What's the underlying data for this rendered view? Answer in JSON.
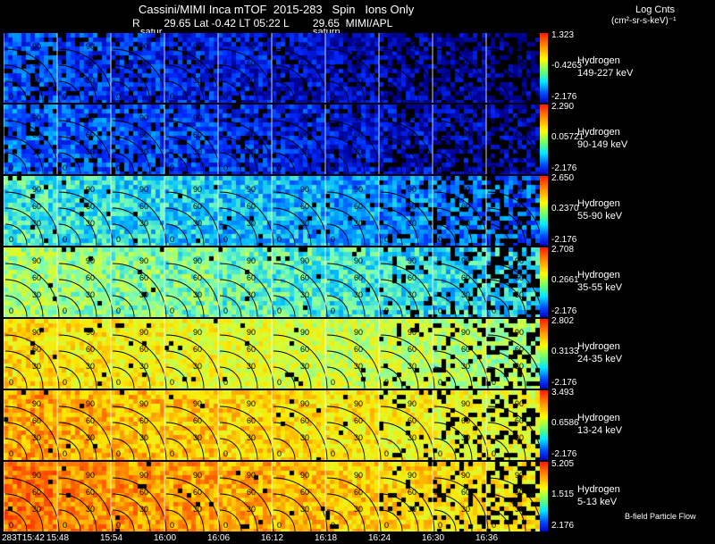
{
  "header": {
    "line1": "Cassini/MIMI Inca mTOF  2015-283   Spin   Ions Only",
    "line2": "R        29.65 Lat -0.42 LT 05:22 L        29.65  MIMI/APL",
    "saturn_1": "satur",
    "saturn_2": "saturn",
    "units_1": "Log Cnts",
    "units_2": "(cm²-sr-s-keV)⁻¹"
  },
  "panels": [
    {
      "species": "Hydrogen",
      "energy": "149-227 keV",
      "max": "1.323",
      "mid": "-0.4263",
      "min": "-2.176",
      "level": 0.18
    },
    {
      "species": "Hydrogen",
      "energy": "90-149 keV",
      "max": "2.290",
      "mid": "0.05721",
      "min": "-2.176",
      "level": 0.22
    },
    {
      "species": "Hydrogen",
      "energy": "55-90 keV",
      "max": "2.650",
      "mid": "0.2370",
      "min": "-2.176",
      "level": 0.4
    },
    {
      "species": "Hydrogen",
      "energy": "35-55 keV",
      "max": "2.708",
      "mid": "0.2661",
      "min": "-2.176",
      "level": 0.52
    },
    {
      "species": "Hydrogen",
      "energy": "24-35 keV",
      "max": "2.802",
      "mid": "0.3133",
      "min": "-2.176",
      "level": 0.7
    },
    {
      "species": "Hydrogen",
      "energy": "13-24 keV",
      "max": "3.493",
      "mid": "0.6586",
      "min": "-2.176",
      "level": 0.8
    },
    {
      "species": "Hydrogen",
      "energy": "5-13 keV",
      "max": "5.205",
      "mid": "1.515",
      "min": "2.176",
      "level": 0.86
    }
  ],
  "contour_labels": [
    "90",
    "60",
    "30",
    "0"
  ],
  "time_axis": [
    "283T15:42",
    "15:48",
    "15:54",
    "16:00",
    "16:06",
    "16:12",
    "16:18",
    "16:24",
    "16:30",
    "16:36"
  ],
  "footer_note": "B-field Particle Flow"
}
